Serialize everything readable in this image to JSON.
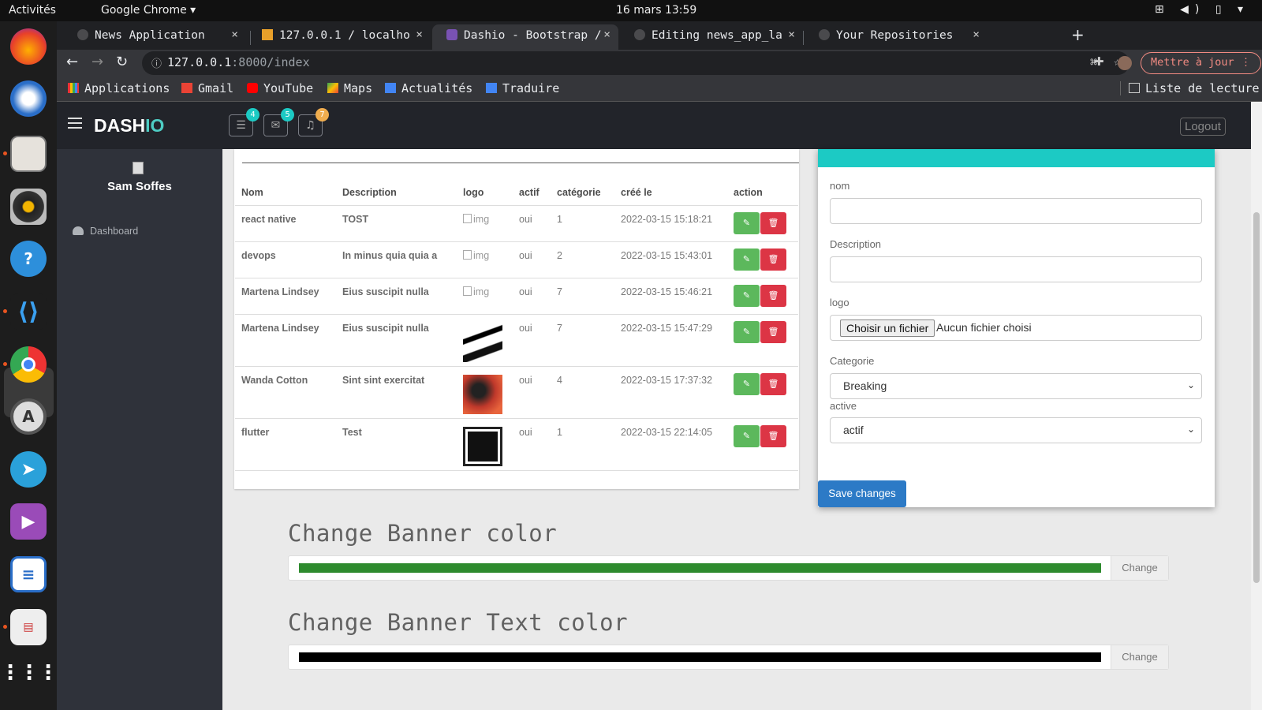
{
  "system": {
    "activities": "Activités",
    "app_name": "Google Chrome ▾",
    "clock": "16 mars 13:59",
    "tray": "⊞ ◀) ▯ ▾"
  },
  "browser": {
    "tabs": [
      {
        "title": "News Application",
        "close": "×"
      },
      {
        "title": "127.0.0.1 / localho",
        "close": "×"
      },
      {
        "title": "Dashio - Bootstrap /",
        "close": "×"
      },
      {
        "title": "Editing news_app_la",
        "close": "×"
      },
      {
        "title": "Your Repositories",
        "close": "×"
      }
    ],
    "new_tab": "+",
    "url_host": "127.0.0.1",
    "url_path": ":8000/index",
    "update_label": "Mettre à jour ⋮",
    "bookmarks": [
      "Applications",
      "Gmail",
      "YouTube",
      "Maps",
      "Actualités",
      "Traduire"
    ],
    "reading_list": "Liste de lecture"
  },
  "app": {
    "logo_main": "DASH",
    "logo_accent": "IO",
    "badges": {
      "tasks": "4",
      "messages": "5",
      "notifications": "7"
    },
    "logout": "Logout",
    "user_name": "Sam Soffes",
    "nav_dashboard": "Dashboard"
  },
  "table": {
    "headers": [
      "Nom",
      "Description",
      "logo",
      "actif",
      "catégorie",
      "créé le",
      "action"
    ],
    "rows": [
      {
        "nom": "react native",
        "description": "TOST",
        "logo": "img",
        "actif": "oui",
        "categorie": "1",
        "cree_le": "2022-03-15 15:18:21"
      },
      {
        "nom": "devops",
        "description": "In minus quia quia a",
        "logo": "img",
        "actif": "oui",
        "categorie": "2",
        "cree_le": "2022-03-15 15:43:01"
      },
      {
        "nom": "Martena Lindsey",
        "description": "Eius suscipit nulla",
        "logo": "img",
        "actif": "oui",
        "categorie": "7",
        "cree_le": "2022-03-15 15:46:21"
      },
      {
        "nom": "Martena Lindsey",
        "description": "Eius suscipit nulla",
        "logo": "",
        "actif": "oui",
        "categorie": "7",
        "cree_le": "2022-03-15 15:47:29"
      },
      {
        "nom": "Wanda Cotton",
        "description": "Sint sint exercitat",
        "logo": "",
        "actif": "oui",
        "categorie": "4",
        "cree_le": "2022-03-15 17:37:32"
      },
      {
        "nom": "flutter",
        "description": "Test",
        "logo": "",
        "actif": "oui",
        "categorie": "1",
        "cree_le": "2022-03-15 22:14:05"
      }
    ]
  },
  "modal": {
    "label_nom": "nom",
    "label_description": "Description",
    "label_logo": "logo",
    "file_button": "Choisir un fichier",
    "file_none": "Aucun fichier choisi",
    "label_categorie": "Categorie",
    "categorie_value": "Breaking",
    "label_active": "active",
    "active_value": "actif",
    "save": "Save changes"
  },
  "banner": {
    "title_color": "Change Banner color",
    "banner_color": "#2e8b2e",
    "title_text_color": "Change Banner Text color",
    "text_color": "#000000",
    "change_label": "Change"
  },
  "colors": {
    "accent": "#4ecdc4",
    "modal_header": "#1ccac4",
    "primary": "#2c7ac6",
    "success": "#5cb85c",
    "danger": "#dc3545"
  }
}
